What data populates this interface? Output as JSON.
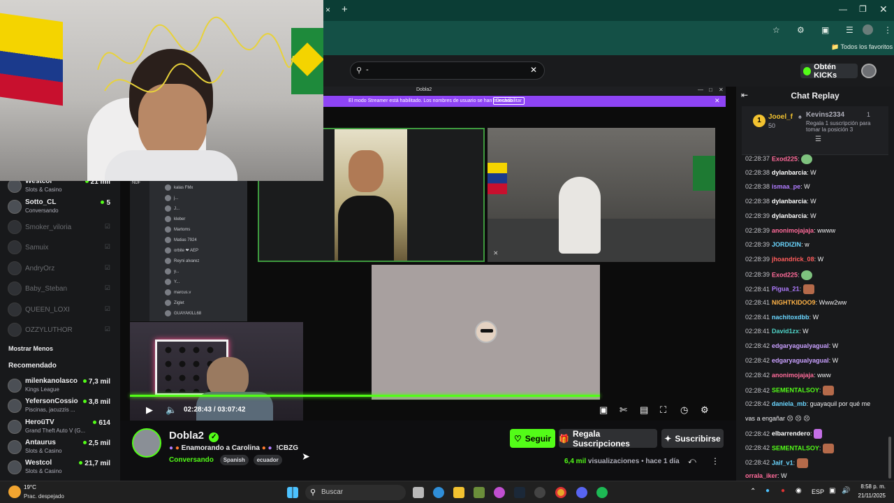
{
  "browser": {
    "favorites_label": "Todos los favoritos",
    "tab_close": "×",
    "tab_new": "+"
  },
  "header": {
    "search_value": "-",
    "get_kicks_label": "Obtén KICKs"
  },
  "webcam_overlay": {
    "ndf": "NDF"
  },
  "streamer_bar": {
    "window_title": "Dobla2",
    "notice": "El modo Streamer está habilitado. Los nombres de usuario se han truncado.",
    "disable_label": "Deshabilitar"
  },
  "discord_list": [
    "kalas FMx",
    "j...",
    "J...",
    "kleber",
    "Martoms",
    "Matias 7924",
    "orbite ❤ AEP",
    "Reyni alvarez",
    "y...",
    "Y...",
    "marcus.v",
    "Ziglet",
    "GUAYAKILL68"
  ],
  "sidebar": {
    "following": [
      {
        "name": "Westcol",
        "sub": "Slots & Casino",
        "count": "21 mil",
        "online": true
      },
      {
        "name": "Sotto_CL",
        "sub": "Conversando",
        "count": "5",
        "online": true
      },
      {
        "name": "Smoker_viloria",
        "online": false
      },
      {
        "name": "Samuix",
        "online": false
      },
      {
        "name": "AndryOrz",
        "online": false
      },
      {
        "name": "Baby_Steban",
        "online": false
      },
      {
        "name": "QUEEN_LOXI",
        "online": false
      },
      {
        "name": "OZZYLUTHOR",
        "online": false
      }
    ],
    "show_less": "Mostrar Menos",
    "recommended_title": "Recomendado",
    "recommended": [
      {
        "name": "milenkanolasco",
        "sub": "Kings League",
        "count": "7,3 mil"
      },
      {
        "name": "YefersonCossio",
        "sub": "Piscinas, jacuzzis ...",
        "count": "3,8 mil"
      },
      {
        "name": "HeroüTV",
        "sub": "Grand Theft Auto V (G...",
        "count": "614"
      },
      {
        "name": "Antaurus",
        "sub": "Slots & Casino",
        "count": "2,5 mil"
      },
      {
        "name": "Westcol",
        "sub": "Slots & Casino",
        "count": "21,7 mil"
      }
    ],
    "offline_icon": "video-off-icon"
  },
  "player": {
    "time_current": "02:28:43",
    "time_separator": "/",
    "time_total": "03:07:42",
    "progress_fraction": 0.79
  },
  "channel": {
    "name": "Dobla2",
    "stream_title": "Enamorando a Carolina",
    "command": "!CBZG",
    "category": "Conversando",
    "tags": [
      "Spanish",
      "ecuador"
    ],
    "follow_label": "Seguir",
    "gift_label": "Regala Suscripciones",
    "subscribe_label": "Suscribirse",
    "views_count": "6,4 mil",
    "views_label": "visualizaciones",
    "age": "hace 1 día",
    "bullet": "•"
  },
  "chat": {
    "title": "Chat Replay",
    "leader": {
      "rank": "1",
      "name": "Jooel_f",
      "amount": "50",
      "top_name": "Kevins2334",
      "top_count": "1",
      "gift_note": "Regala 1 suscripción para tomar la posición 3"
    },
    "messages": [
      {
        "t": "02:28:37",
        "u": "Exod225",
        "color": "#ff6b9a",
        "text": "",
        "emote": "round"
      },
      {
        "t": "02:28:38",
        "u": "dylanbarcia",
        "color": "#ffffff",
        "text": " W"
      },
      {
        "t": "02:28:38",
        "u": "ismaa_pe",
        "color": "#b07cff",
        "text": " W"
      },
      {
        "t": "02:28:38",
        "u": "dylanbarcia",
        "color": "#ffffff",
        "text": " W"
      },
      {
        "t": "02:28:39",
        "u": "dylanbarcia",
        "color": "#ffffff",
        "text": " W"
      },
      {
        "t": "02:28:39",
        "u": "anonimojajaja",
        "color": "#ff6b9a",
        "text": " wwww"
      },
      {
        "t": "02:28:39",
        "u": "JORDIZIN",
        "color": "#6ad6ff",
        "text": " w"
      },
      {
        "t": "02:28:39",
        "u": "jhoandrick_08",
        "color": "#ff5c5c",
        "text": " W"
      },
      {
        "t": "02:28:39",
        "u": "Exod225",
        "color": "#ff6b9a",
        "text": "",
        "emote": "round"
      },
      {
        "t": "02:28:41",
        "u": "Pigua_21",
        "color": "#b07cff",
        "text": "",
        "emote": "face"
      },
      {
        "t": "02:28:41",
        "u": "NIGHTKIDOO9",
        "color": "#ffb347",
        "text": " Www2ww"
      },
      {
        "t": "02:28:41",
        "u": "nachitoxdbb",
        "color": "#6ad6ff",
        "text": " W"
      },
      {
        "t": "02:28:41",
        "u": "David1zx",
        "color": "#4fd1c5",
        "text": " W"
      },
      {
        "t": "02:28:42",
        "u": "edgaryagualyagual",
        "color": "#c9a0ff",
        "text": " W"
      },
      {
        "t": "02:28:42",
        "u": "edgaryagualyagual",
        "color": "#c9a0ff",
        "text": " W"
      },
      {
        "t": "02:28:42",
        "u": "anonimojajaja",
        "color": "#ff6b9a",
        "text": " www"
      },
      {
        "t": "02:28:42",
        "u": "SEMENTALSOY",
        "color": "#53fc18",
        "text": "",
        "emote": "face"
      },
      {
        "t": "02:28:42",
        "u": "daniela_mb",
        "color": "#6ad6ff",
        "text": " guayaquil por qué me"
      },
      {
        "t": "",
        "u": "",
        "color": "#ffffff",
        "text": "vas a engañar ☹ ☹ ☹"
      },
      {
        "t": "02:28:42",
        "u": "elbarrendero",
        "color": "#ffffff",
        "text": "",
        "emote": "butterfly"
      },
      {
        "t": "02:28:42",
        "u": "SEMENTALSOY",
        "color": "#53fc18",
        "text": "",
        "emote": "face"
      },
      {
        "t": "02:28:42",
        "u": "Jaif_v1",
        "color": "#6ad6ff",
        "text": "",
        "emote": "face"
      },
      {
        "t": "",
        "u": "orrala_iker",
        "color": "#ff6b9a",
        "text": " W"
      }
    ]
  },
  "taskbar": {
    "temp": "19°C",
    "weather": "Prac. despejado",
    "search_placeholder": "Buscar",
    "lang": "ESP",
    "time": "8:58 p. m.",
    "date": "21/11/2025"
  },
  "colors": {
    "kick_green": "#53fc18",
    "streamer_purple": "#8e44f5",
    "chrome_green": "#145046"
  }
}
